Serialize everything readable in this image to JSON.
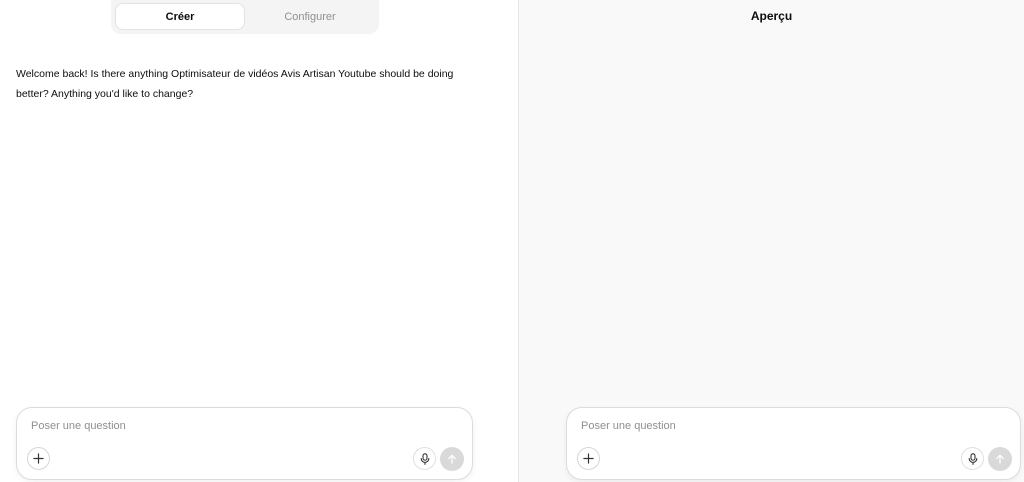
{
  "tabs": {
    "create_label": "Créer",
    "configure_label": "Configurer"
  },
  "builder": {
    "message": "Welcome back! Is there anything Optimisateur de vidéos Avis Artisan Youtube should be doing better? Anything you'd like to change?",
    "composer": {
      "placeholder": "Poser une question"
    }
  },
  "preview": {
    "title": "Aperçu",
    "composer": {
      "placeholder": "Poser une question"
    }
  },
  "icons": {
    "plus": "plus-icon",
    "mic": "microphone-icon",
    "send": "arrow-up-icon"
  },
  "colors": {
    "preview_background": "#f9f9f9",
    "send_button_disabled": "#d9d9d9"
  }
}
